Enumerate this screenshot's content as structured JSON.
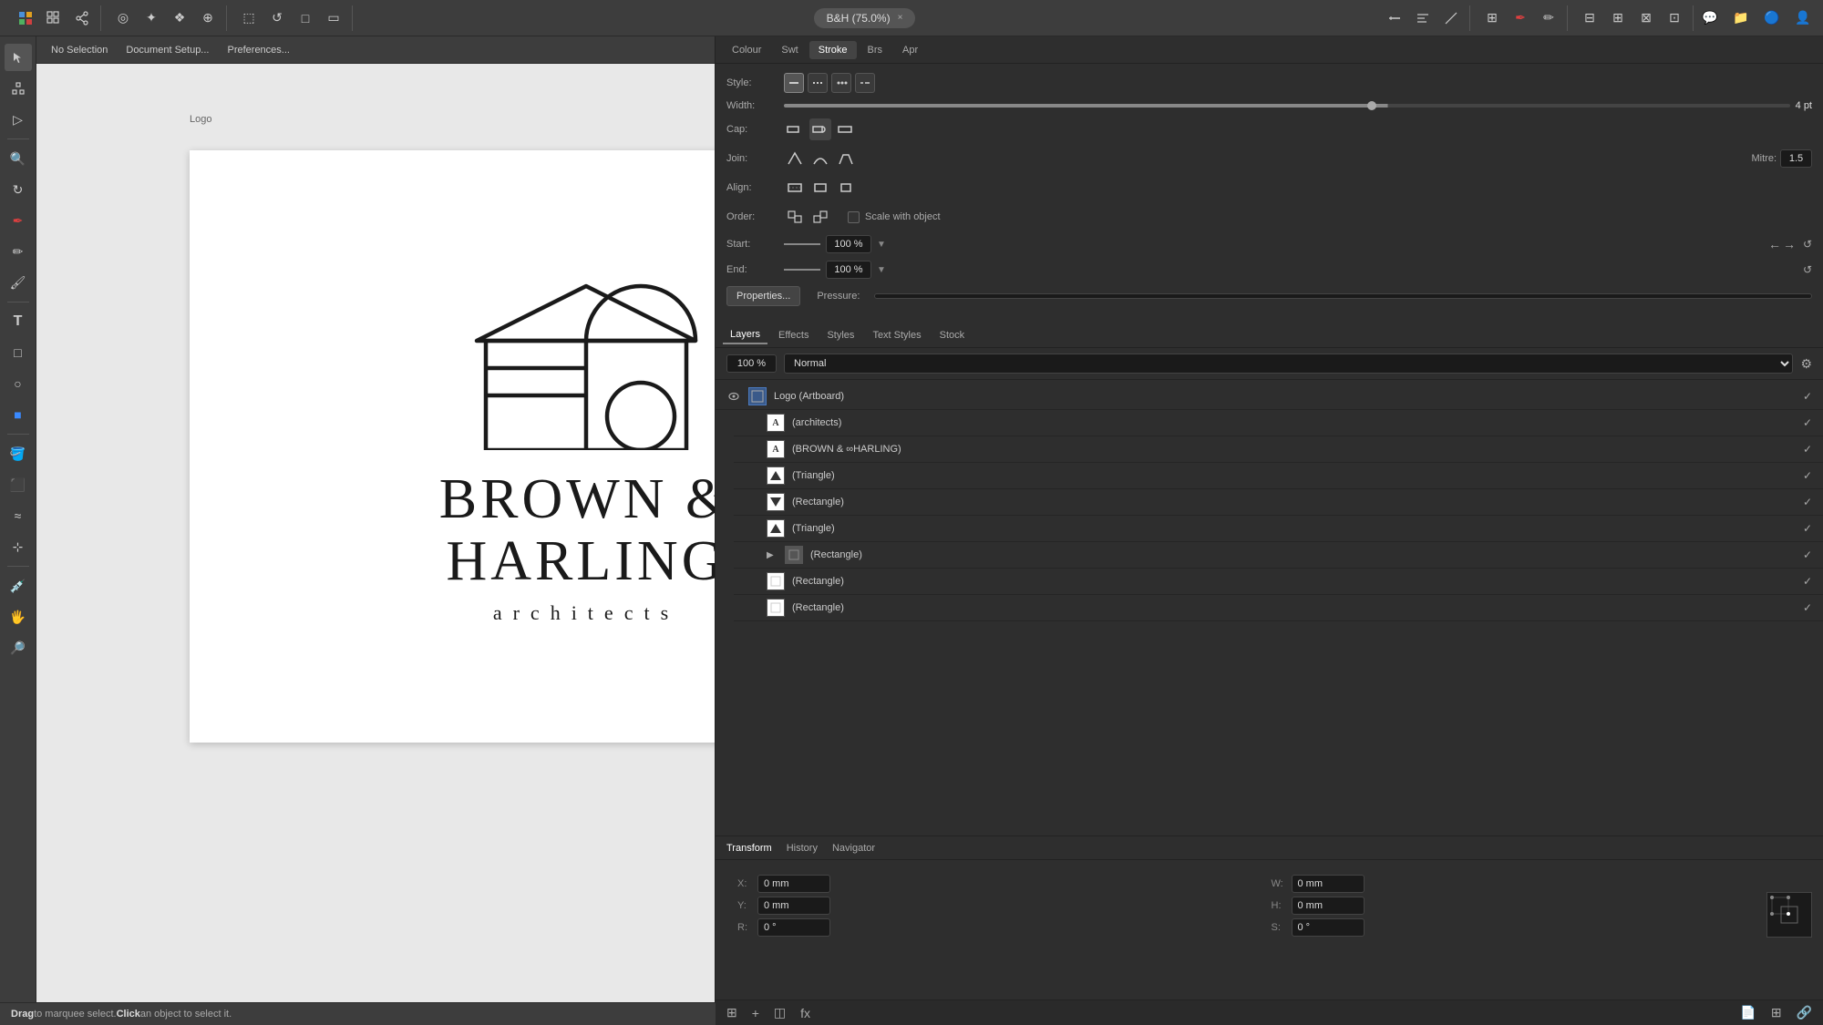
{
  "app": {
    "title": "B&H (75.0%)",
    "close_label": "×"
  },
  "toolbar": {
    "no_selection": "No Selection",
    "document_setup": "Document Setup...",
    "preferences": "Preferences..."
  },
  "canvas": {
    "label": "Logo"
  },
  "logo": {
    "line1": "BROWN &",
    "line2": "HARLING",
    "subtitle": "architects"
  },
  "panel": {
    "tabs": [
      "Colour",
      "Swt",
      "Stroke",
      "Brs",
      "Apr"
    ],
    "active_tab": "Stroke",
    "style_label": "Style:",
    "width_label": "Width:",
    "width_value": "4 pt",
    "cap_label": "Cap:",
    "join_label": "Join:",
    "mitre_label": "Mitre:",
    "mitre_value": "1.5",
    "align_label": "Align:",
    "order_label": "Order:",
    "scale_label": "Scale with object",
    "start_label": "Start:",
    "start_pct": "100 %",
    "end_label": "End:",
    "end_pct": "100 %",
    "properties_btn": "Properties...",
    "pressure_label": "Pressure:"
  },
  "sub_panel": {
    "tabs": [
      "Layers",
      "Effects",
      "Styles",
      "Text Styles",
      "Stock"
    ],
    "active_tab": "Layers"
  },
  "opacity": {
    "value": "100 %",
    "blend": "Normal"
  },
  "layers": [
    {
      "name": "Logo (Artboard)",
      "indent": 0,
      "has_eye": true,
      "is_artboard": true,
      "checked": true,
      "thumb_type": "artboard"
    },
    {
      "name": "(architects)",
      "indent": 1,
      "has_eye": false,
      "checked": true,
      "thumb_type": "text"
    },
    {
      "name": "(BROWN & ∞HARLING)",
      "indent": 1,
      "has_eye": false,
      "checked": true,
      "thumb_type": "text"
    },
    {
      "name": "(Triangle)",
      "indent": 1,
      "has_eye": false,
      "checked": true,
      "thumb_type": "triangle-up"
    },
    {
      "name": "(Rectangle)",
      "indent": 1,
      "has_eye": false,
      "checked": true,
      "thumb_type": "rect-dark"
    },
    {
      "name": "(Triangle)",
      "indent": 1,
      "has_eye": false,
      "checked": true,
      "thumb_type": "triangle-up"
    },
    {
      "name": "(Rectangle)",
      "indent": 1,
      "has_eye": false,
      "checked": true,
      "thumb_type": "rect-dark",
      "expandable": true
    },
    {
      "name": "(Rectangle)",
      "indent": 1,
      "has_eye": false,
      "checked": true,
      "thumb_type": "rect-white"
    },
    {
      "name": "(Rectangle)",
      "indent": 1,
      "has_eye": false,
      "checked": true,
      "thumb_type": "rect-white"
    }
  ],
  "transform": {
    "tabs": [
      "Transform",
      "History",
      "Navigator"
    ],
    "active_tab": "Transform",
    "x_label": "X:",
    "x_value": "0 mm",
    "w_label": "W:",
    "w_value": "0 mm",
    "y_label": "Y:",
    "y_value": "0 mm",
    "h_label": "H:",
    "h_value": "0 mm",
    "r_label": "R:",
    "r_value": "0 °",
    "s_label": "S:",
    "s_value": "0 °"
  },
  "status": {
    "drag_text": "Drag",
    "to_text": " to marquee select. ",
    "click_text": "Click",
    "obj_text": " an object to select it."
  }
}
